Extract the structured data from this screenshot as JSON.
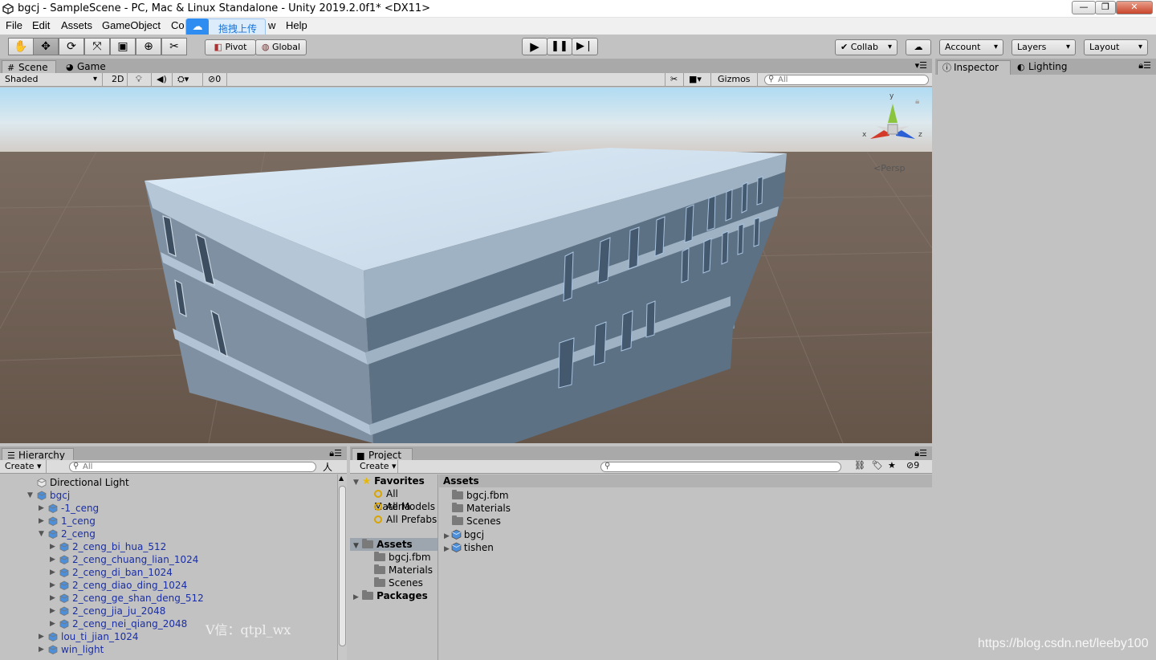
{
  "window": {
    "title": "bgcj - SampleScene - PC, Mac & Linux Standalone - Unity 2019.2.0f1* <DX11>",
    "controls": [
      "—",
      "❐",
      "✕"
    ]
  },
  "menu": [
    "File",
    "Edit",
    "Assets",
    "GameObject",
    "Co",
    "w",
    "Help"
  ],
  "upload_overlay": {
    "label": "拖拽上传"
  },
  "toolbar": {
    "tools": [
      "hand-icon",
      "move-icon",
      "rotate-icon",
      "scale-icon",
      "rect-icon",
      "transform-icon",
      "custom-tool-icon"
    ],
    "pivot": "Pivot",
    "global": "Global",
    "collab": "Collab",
    "account": "Account",
    "layers": "Layers",
    "layout": "Layout"
  },
  "scene_panel": {
    "tabs": [
      "Scene",
      "Game"
    ],
    "shading": "Shaded",
    "mode_2d": "2D",
    "hidden_count": "0",
    "gizmos": "Gizmos",
    "search_placeholder": "All",
    "gizmo_axes": {
      "y": "y",
      "x": "x",
      "z": "z"
    },
    "projection": "Persp"
  },
  "inspector": {
    "tabs": [
      "Inspector",
      "Lighting"
    ]
  },
  "hierarchy": {
    "tab": "Hierarchy",
    "create": "Create",
    "search_placeholder": "All",
    "items": [
      {
        "label": "Directional Light",
        "depth": 0,
        "arrow": "",
        "blue": false
      },
      {
        "label": "bgcj",
        "depth": 0,
        "arrow": "▼",
        "blue": true
      },
      {
        "label": "-1_ceng",
        "depth": 1,
        "arrow": "▶",
        "blue": true
      },
      {
        "label": "1_ceng",
        "depth": 1,
        "arrow": "▶",
        "blue": true
      },
      {
        "label": "2_ceng",
        "depth": 1,
        "arrow": "▼",
        "blue": true
      },
      {
        "label": "2_ceng_bi_hua_512",
        "depth": 2,
        "arrow": "▶",
        "blue": true
      },
      {
        "label": "2_ceng_chuang_lian_1024",
        "depth": 2,
        "arrow": "▶",
        "blue": true
      },
      {
        "label": "2_ceng_di_ban_1024",
        "depth": 2,
        "arrow": "▶",
        "blue": true
      },
      {
        "label": "2_ceng_diao_ding_1024",
        "depth": 2,
        "arrow": "▶",
        "blue": true
      },
      {
        "label": "2_ceng_ge_shan_deng_512",
        "depth": 2,
        "arrow": "▶",
        "blue": true
      },
      {
        "label": "2_ceng_jia_ju_2048",
        "depth": 2,
        "arrow": "▶",
        "blue": true
      },
      {
        "label": "2_ceng_nei_qiang_2048",
        "depth": 2,
        "arrow": "▶",
        "blue": true
      },
      {
        "label": "lou_ti_jian_1024",
        "depth": 1,
        "arrow": "▶",
        "blue": true
      },
      {
        "label": "win_light",
        "depth": 1,
        "arrow": "▶",
        "blue": true
      }
    ]
  },
  "project": {
    "tab": "Project",
    "create": "Create",
    "hidden_count": "9",
    "tree": {
      "favorites": "Favorites",
      "favorite_items": [
        "All Materia",
        "All Models",
        "All Prefabs"
      ],
      "assets": "Assets",
      "asset_folders": [
        "bgcj.fbm",
        "Materials",
        "Scenes"
      ],
      "packages": "Packages"
    },
    "content_header": "Assets",
    "content_items": [
      {
        "label": "bgcj.fbm",
        "type": "folder"
      },
      {
        "label": "Materials",
        "type": "folder"
      },
      {
        "label": "Scenes",
        "type": "folder"
      },
      {
        "label": "bgcj",
        "type": "model"
      },
      {
        "label": "tishen",
        "type": "model"
      }
    ]
  },
  "watermarks": {
    "wechat": "V信：qtpl_wx",
    "blog": "https://blog.csdn.net/leeby100"
  }
}
